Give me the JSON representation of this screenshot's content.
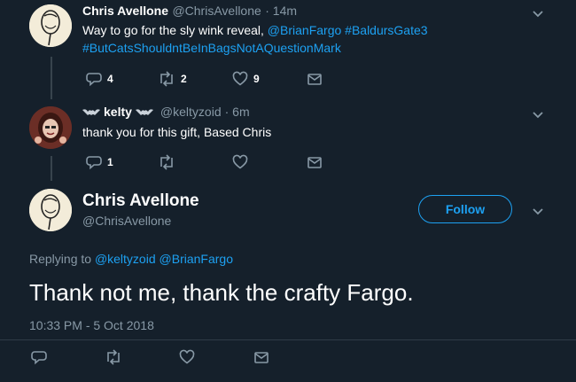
{
  "tweet1": {
    "name": "Chris Avellone",
    "handle": "@ChrisAvellone",
    "time": "· 14m",
    "text": "Way to go for the sly wink reveal,",
    "mention1": "@BrianFargo",
    "hashtag1": "#BaldursGate3",
    "hashtag2": "#ButCatsShouldntBeInBagsNotAQuestionMark",
    "replies": "4",
    "retweets": "2",
    "likes": "9"
  },
  "tweet2": {
    "name": "kelty",
    "handle": "@keltyzoid",
    "time": "· 6m",
    "text": "thank you for this gift, Based Chris",
    "replies": "1"
  },
  "main": {
    "name": "Chris Avellone",
    "handle": "@ChrisAvellone",
    "follow_label": "Follow",
    "replying_to": "Replying to",
    "reply_mention1": "@keltyzoid",
    "reply_mention2": "@BrianFargo",
    "text": "Thank not me, thank the crafty Fargo.",
    "timestamp": "10:33 PM - 5 Oct 2018"
  },
  "colors": {
    "background": "#15202b",
    "accent": "#1da1f2",
    "muted": "#8899a6"
  }
}
